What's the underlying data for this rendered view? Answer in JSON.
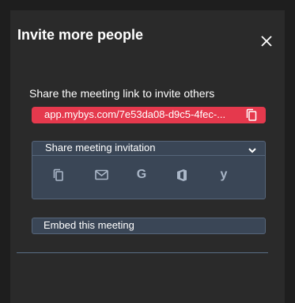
{
  "dialog": {
    "title": "Invite more people",
    "close_icon": "close-icon"
  },
  "share_link": {
    "label": "Share the meeting link to invite others",
    "url": "app.mybys.com/7e53da08-d9c5-4fec-...",
    "copy_icon": "copy-icon",
    "accent_color": "#e5394d"
  },
  "invitation": {
    "label": "Share meeting invitation",
    "toggle_icon": "chevron-down-icon",
    "options": [
      {
        "icon": "copy-icon"
      },
      {
        "icon": "email-icon"
      },
      {
        "icon": "google-icon",
        "glyph": "G"
      },
      {
        "icon": "office-icon"
      },
      {
        "icon": "yahoo-icon",
        "glyph": "y"
      }
    ]
  },
  "embed": {
    "label": "Embed this meeting"
  }
}
